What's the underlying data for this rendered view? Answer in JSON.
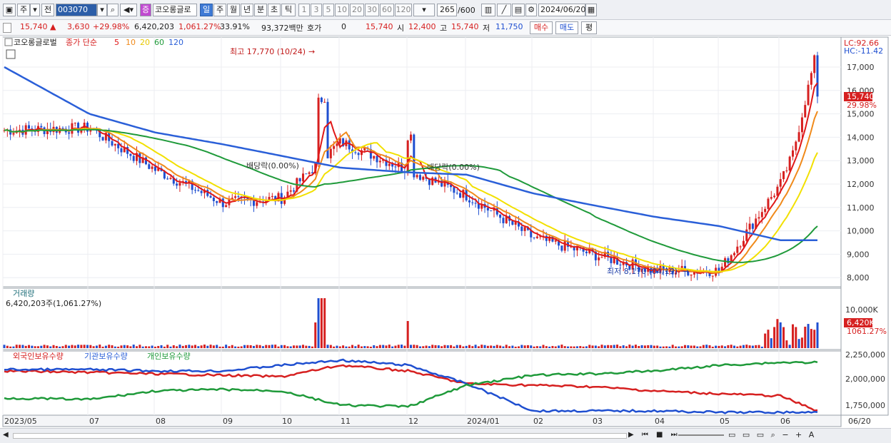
{
  "toolbar": {
    "market": "주",
    "prev": "전",
    "code": "003070",
    "stock_name": "코오롱글로",
    "periods": [
      "일",
      "주",
      "월",
      "년",
      "분",
      "초",
      "틱"
    ],
    "active_period": "일",
    "intervals": [
      "1",
      "3",
      "5",
      "10",
      "20",
      "30",
      "60",
      "120"
    ],
    "count": "265",
    "count_total": "/600",
    "date": "2024/06/20"
  },
  "quote": {
    "price": "15,740",
    "change": "3,630",
    "change_pct": "+29.98%",
    "volume": "6,420,203",
    "volume_pct": "1,061.27%",
    "turnover_pct": "33.91%",
    "amount": "93,372백만",
    "hoga_label": "호가",
    "hoga_value": "0",
    "hoga_price": "15,740",
    "open_label": "시",
    "open": "12,400",
    "high_label": "고",
    "high": "15,740",
    "low_label": "저",
    "low": "11,750",
    "buy": "매수",
    "sell": "매도",
    "eval": "평"
  },
  "colors": {
    "up": "#d62020",
    "down": "#1f4fd0",
    "ma5": "#e01818",
    "ma10": "#f08a1a",
    "ma20": "#f2e000",
    "ma60": "#1f9a3a",
    "ma120": "#2a5fd8"
  },
  "price_panel": {
    "title": "코오롱글로벌",
    "legend": "종가 단순",
    "ma_periods": [
      "5",
      "10",
      "20",
      "60",
      "120"
    ],
    "lc": "LC:92.66",
    "hc": "HC:-11.42",
    "y_ticks": [
      "17,000",
      "16,000",
      "15,000",
      "14,000",
      "13,000",
      "12,000",
      "11,000",
      "10,000",
      "9,000",
      "8,000"
    ],
    "last_price": "15,740",
    "last_pct": "29.98%",
    "annotation_high": "최고 17,770 (10/24)",
    "annotation_low": "최저 8,170 (04/19)",
    "annotation_div1": "배당락(0.00%)",
    "annotation_div2": "배당락(0.00%)"
  },
  "volume_panel": {
    "title": "거래량",
    "value": "6,420,203주(1,061.27%)",
    "y_tick": "10,000K",
    "last_value": "6,420K",
    "last_pct": "1061.27%"
  },
  "holding_panel": {
    "legend": [
      "외국인보유수량",
      "기관보유수량",
      "개인보유수량"
    ],
    "y_ticks": [
      "2,250,000",
      "2,000,000",
      "1,750,000"
    ]
  },
  "x_axis": [
    "2023/05",
    "07",
    "08",
    "09",
    "10",
    "11",
    "12",
    "2024/01",
    "02",
    "03",
    "04",
    "05",
    "06",
    "06/20"
  ],
  "chart_data": {
    "type": "line",
    "title": "",
    "x": [
      "2023/05",
      "07",
      "08",
      "09",
      "10",
      "11",
      "12",
      "2024/01",
      "02",
      "03",
      "04",
      "05",
      "06",
      "06/20"
    ],
    "series": [
      {
        "name": "종가",
        "values": [
          14300,
          14400,
          12600,
          11200,
          11400,
          13800,
          12600,
          11500,
          9700,
          9000,
          8300,
          8300,
          12000,
          15740
        ]
      },
      {
        "name": "120",
        "values": [
          17000,
          15000,
          14200,
          13700,
          13200,
          12700,
          12500,
          12400,
          11600,
          11100,
          10600,
          10200,
          9600,
          9600
        ]
      }
    ],
    "ylim": [
      7800,
      17800
    ],
    "annotations": [
      "최고 17,770 (10/24)",
      "최저 8,170 (04/19)"
    ]
  }
}
